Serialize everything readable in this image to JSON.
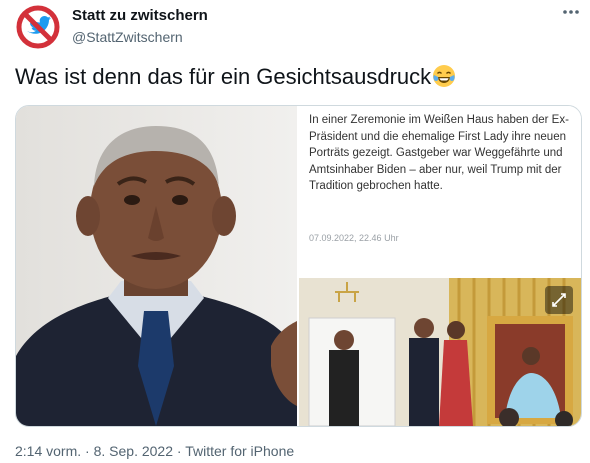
{
  "author": {
    "name": "Statt zu zwitschern",
    "handle": "@StattZwitschern",
    "avatar_icon": "no-twitter-bird-icon"
  },
  "more_icon": "more-horizontal-icon",
  "tweet": {
    "text": "Was ist denn das für ein Gesichtsausdruck",
    "emoji_icon": "face-with-tears-of-joy-icon"
  },
  "media": {
    "news_text": "In einer Zeremonie im Weißen Haus haben der Ex-Präsident und die ehemalige First Lady ihre neuen Porträts gezeigt. Gastgeber war Weggefährte und Amtsinhaber Biden – aber nur, weil Trump mit der Tradition gebrochen hatte.",
    "news_date": "07.09.2022, 22.46 Uhr",
    "expand_icon": "expand-icon"
  },
  "footer": {
    "time": "2:14 vorm.",
    "date": "8. Sep. 2022",
    "source": "Twitter for iPhone",
    "separator": "·"
  },
  "colors": {
    "text": "#0f1419",
    "secondary": "#536471",
    "border": "#cfd9de",
    "prohibition_red": "#d3313a",
    "twitter_blue": "#1d9bf0"
  }
}
